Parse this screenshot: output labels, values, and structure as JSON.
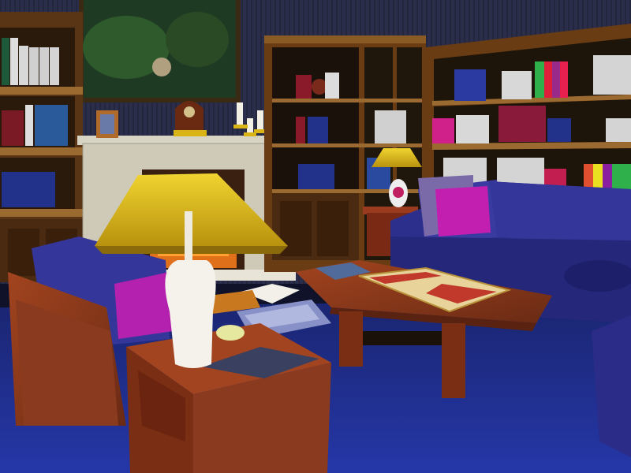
{
  "scene": {
    "description_tag": "3d-rendered-library-living-room",
    "colors": {
      "wall": "#2a2d4a",
      "carpet": "#1f2f8f",
      "wood": "#8a3a1e",
      "sofa": "#3a3ba0",
      "lampshade": "#d8b417",
      "fireplace": "#cfcab8",
      "pillow": "#c21fb0"
    },
    "objects": [
      "painting",
      "mantel-clock",
      "candles",
      "fireplace",
      "bookshelf-left",
      "bookshelf-center",
      "bookshelf-right",
      "table-lamp-left",
      "table-lamp-back",
      "armchair",
      "side-table",
      "coffee-table",
      "backgammon-board",
      "sofa",
      "floor-cushions",
      "open-book",
      "ashtray",
      "magazine"
    ]
  }
}
